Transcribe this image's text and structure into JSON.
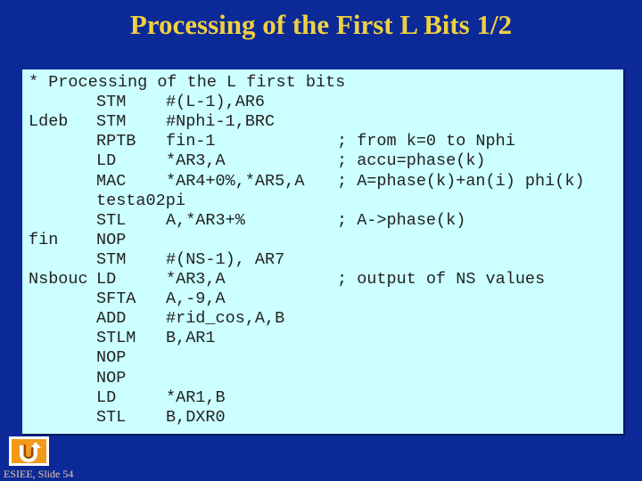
{
  "title": "Processing of the First L Bits 1/2",
  "code": [
    {
      "label": "* Processing of the L first bits",
      "op": "",
      "args": "",
      "comment": ""
    },
    {
      "label": "",
      "op": "STM",
      "args": "#(L-1),AR6",
      "comment": ""
    },
    {
      "label": "Ldeb",
      "op": "STM",
      "args": "#Nphi-1,BRC",
      "comment": ""
    },
    {
      "label": "",
      "op": "RPTB",
      "args": "fin-1",
      "comment": "; from k=0 to Nphi"
    },
    {
      "label": "",
      "op": "LD",
      "args": "*AR3,A",
      "comment": "; accu=phase(k)"
    },
    {
      "label": "",
      "op": "MAC",
      "args": "*AR4+0%,*AR5,A",
      "comment": "; A=phase(k)+an(i) phi(k)"
    },
    {
      "label": "",
      "op": "testa02pi",
      "args": "",
      "comment": ""
    },
    {
      "label": "",
      "op": "STL",
      "args": "A,*AR3+%",
      "comment": "; A->phase(k)"
    },
    {
      "label": "fin",
      "op": "NOP",
      "args": "",
      "comment": ""
    },
    {
      "label": "",
      "op": "STM",
      "args": "#(NS-1), AR7",
      "comment": ""
    },
    {
      "label": "Nsbouc",
      "op": "LD",
      "args": "*AR3,A",
      "comment": "; output of NS values"
    },
    {
      "label": "",
      "op": "SFTA",
      "args": "A,-9,A",
      "comment": ""
    },
    {
      "label": "",
      "op": "ADD",
      "args": "#rid_cos,A,B",
      "comment": ""
    },
    {
      "label": "",
      "op": "STLM",
      "args": "B,AR1",
      "comment": ""
    },
    {
      "label": "",
      "op": "NOP",
      "args": "",
      "comment": ""
    },
    {
      "label": "",
      "op": "NOP",
      "args": "",
      "comment": ""
    },
    {
      "label": "",
      "op": "LD",
      "args": "*AR1,B",
      "comment": ""
    },
    {
      "label": "",
      "op": "STL",
      "args": "B,DXR0",
      "comment": ""
    }
  ],
  "footer": "ESIEE, Slide 54",
  "home_icon": "return-arrow-icon"
}
